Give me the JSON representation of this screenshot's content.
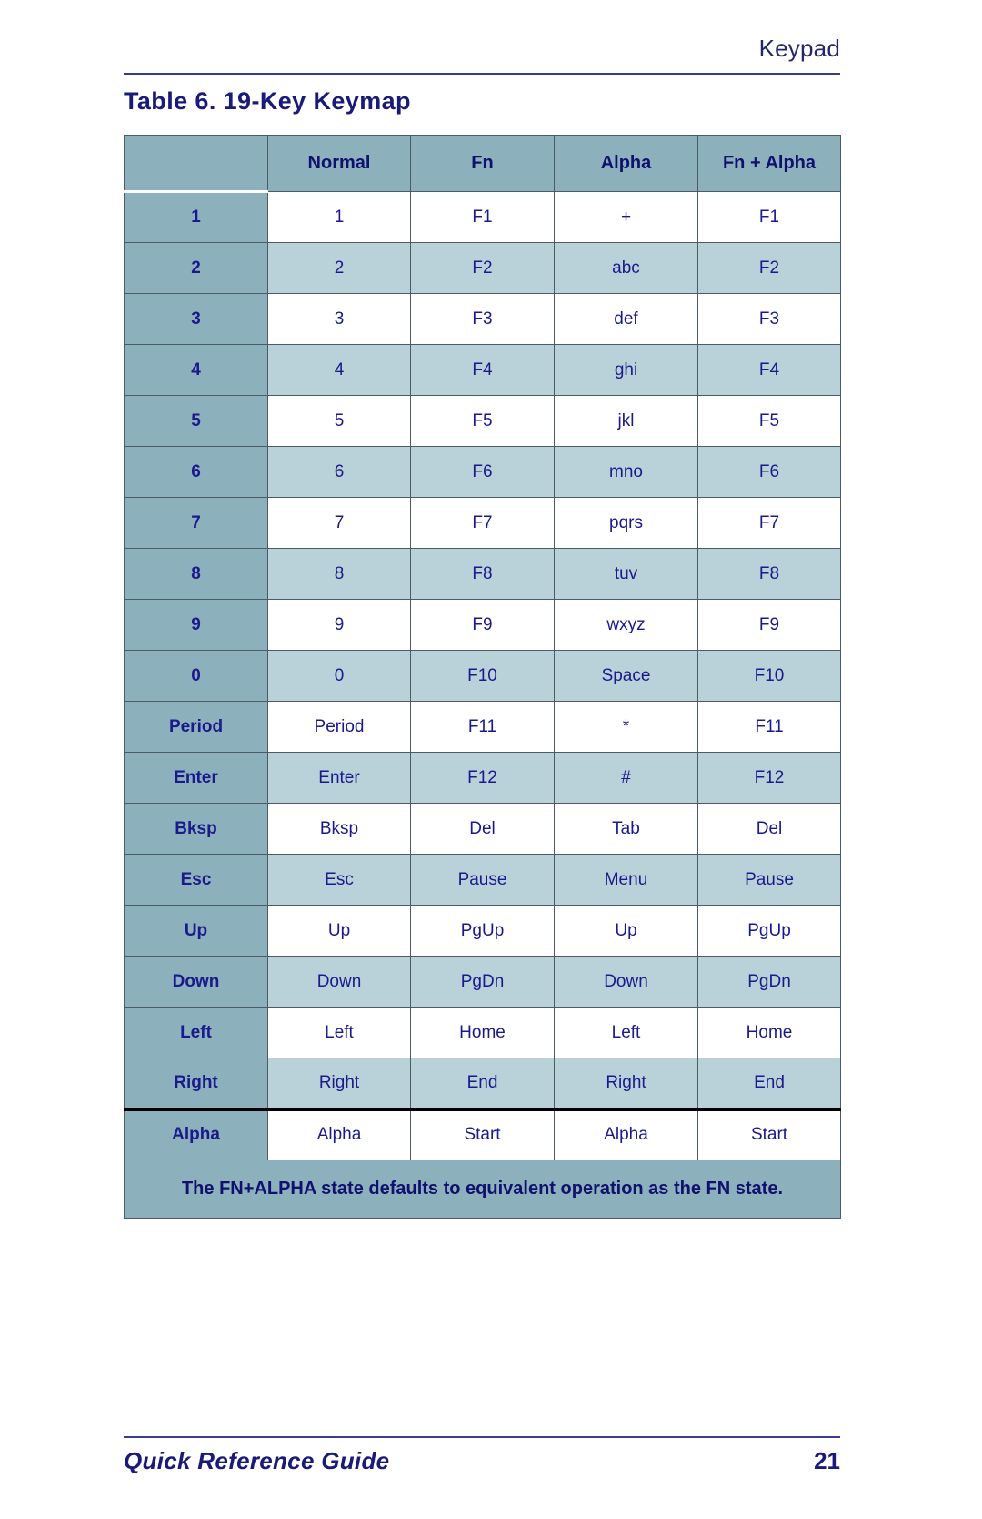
{
  "header": {
    "running_head": "Keypad"
  },
  "caption": "Table 6. 19-Key Keymap",
  "table": {
    "columns": [
      "",
      "Normal",
      "Fn",
      "Alpha",
      "Fn + Alpha"
    ],
    "rows": [
      {
        "key": "1",
        "normal": "1",
        "fn": "F1",
        "alpha": "+",
        "fn_alpha": "F1"
      },
      {
        "key": "2",
        "normal": "2",
        "fn": "F2",
        "alpha": "abc",
        "fn_alpha": "F2"
      },
      {
        "key": "3",
        "normal": "3",
        "fn": "F3",
        "alpha": "def",
        "fn_alpha": "F3"
      },
      {
        "key": "4",
        "normal": "4",
        "fn": "F4",
        "alpha": "ghi",
        "fn_alpha": "F4"
      },
      {
        "key": "5",
        "normal": "5",
        "fn": "F5",
        "alpha": "jkl",
        "fn_alpha": "F5"
      },
      {
        "key": "6",
        "normal": "6",
        "fn": "F6",
        "alpha": "mno",
        "fn_alpha": "F6"
      },
      {
        "key": "7",
        "normal": "7",
        "fn": "F7",
        "alpha": "pqrs",
        "fn_alpha": "F7"
      },
      {
        "key": "8",
        "normal": "8",
        "fn": "F8",
        "alpha": "tuv",
        "fn_alpha": "F8"
      },
      {
        "key": "9",
        "normal": "9",
        "fn": "F9",
        "alpha": "wxyz",
        "fn_alpha": "F9"
      },
      {
        "key": "0",
        "normal": "0",
        "fn": "F10",
        "alpha": "Space",
        "fn_alpha": "F10"
      },
      {
        "key": "Period",
        "normal": "Period",
        "fn": "F11",
        "alpha": "*",
        "fn_alpha": "F11"
      },
      {
        "key": "Enter",
        "normal": "Enter",
        "fn": "F12",
        "alpha": "#",
        "fn_alpha": "F12"
      },
      {
        "key": "Bksp",
        "normal": "Bksp",
        "fn": "Del",
        "alpha": "Tab",
        "fn_alpha": "Del"
      },
      {
        "key": "Esc",
        "normal": "Esc",
        "fn": "Pause",
        "alpha": "Menu",
        "fn_alpha": "Pause"
      },
      {
        "key": "Up",
        "normal": "Up",
        "fn": "PgUp",
        "alpha": "Up",
        "fn_alpha": "PgUp"
      },
      {
        "key": "Down",
        "normal": "Down",
        "fn": "PgDn",
        "alpha": "Down",
        "fn_alpha": "PgDn"
      },
      {
        "key": "Left",
        "normal": "Left",
        "fn": "Home",
        "alpha": "Left",
        "fn_alpha": "Home"
      },
      {
        "key": "Right",
        "normal": "Right",
        "fn": "End",
        "alpha": "Right",
        "fn_alpha": "End"
      },
      {
        "key": "Alpha",
        "normal": "Alpha",
        "fn": "Start",
        "alpha": "Alpha",
        "fn_alpha": "Start"
      }
    ],
    "note": "The FN+ALPHA state defaults to equivalent operation as the FN state."
  },
  "footer": {
    "title": "Quick Reference Guide",
    "page_number": "21"
  },
  "colors": {
    "text_blue": "#1a1a8c",
    "header_fill": "#8cb0bc",
    "row_alt_fill": "#b9d1d8",
    "rule": "#3b3b8f",
    "cell_border": "#4d5b66"
  }
}
